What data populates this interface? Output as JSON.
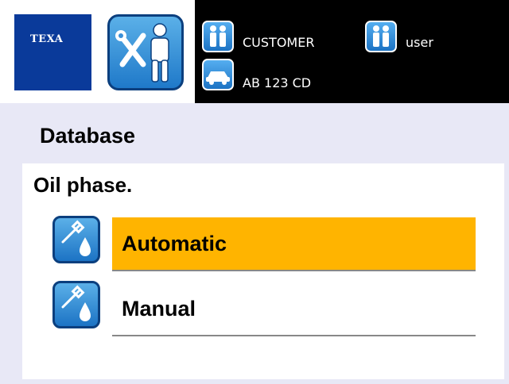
{
  "header": {
    "brand": "TEXA",
    "customer_label": "CUSTOMER",
    "user_label": "user",
    "plate": "AB 123 CD"
  },
  "page": {
    "title": "Database",
    "prompt": "Oil phase."
  },
  "options": [
    {
      "label": "Automatic",
      "selected": true
    },
    {
      "label": "Manual",
      "selected": false
    }
  ],
  "colors": {
    "selected_bg": "#ffb400",
    "brand_blue": "#0a3a9a",
    "icon_blue": "#1c73c4",
    "page_bg": "#e8e8f6"
  },
  "icons": {
    "mode": "mechanic-tools-icon",
    "customer": "people-icon",
    "user": "people-icon",
    "vehicle": "car-icon",
    "option": "oil-dropper-icon"
  }
}
